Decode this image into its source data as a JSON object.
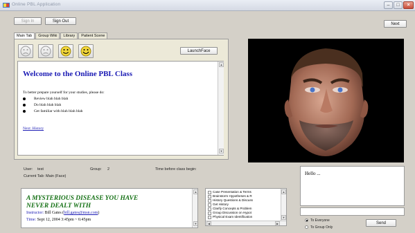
{
  "window": {
    "title": "Online PBL Application",
    "buttons": {
      "minimize": "–",
      "maximize": "□",
      "close": "×"
    }
  },
  "toolbar": {
    "sign_in": "Sign In",
    "sign_out": "Sign Out",
    "next": "Next"
  },
  "tabs": [
    {
      "label": "Main Tab",
      "active": true
    },
    {
      "label": "Group Wiki",
      "active": false
    },
    {
      "label": "Library",
      "active": false
    },
    {
      "label": "Patient Scene",
      "active": false
    }
  ],
  "face_icons": [
    "sad-face-icon",
    "sad-face-icon",
    "happy-face-icon",
    "happy-face-icon"
  ],
  "launch_face": "LaunchFace",
  "welcome": {
    "heading": "Welcome to the Online PBL Class",
    "intro": "To better prepare yourself for your studies, please do:",
    "items": [
      "Review blah blah blah",
      "Do blah blah blah",
      "Get familiar with blah blah blah"
    ],
    "next_link": "Next: History"
  },
  "status": {
    "user_label": "User:",
    "user_value": "test",
    "group_label": "Group:",
    "group_value": "2",
    "time_label": "Time before class begin:",
    "tab_label": "Current Tab:",
    "tab_value": "Main (Face)"
  },
  "announcement": {
    "title_line1": "A MYSTERIOUS DISEASE YOU HAVE",
    "title_line2": "NEVER DEALT WITH",
    "instructor_label": "Instructor:",
    "instructor_name": "Bill Gates",
    "instructor_email": "bill.gates@msn.com",
    "time_label": "Time:",
    "time_value": "Sept 12, 2004 3:45pm ~ 6:45pm"
  },
  "checklist": [
    "Case Presentation & Terms",
    "Brainstorm Hypotheses & R",
    "History Questions & Discuss",
    "Get History",
    "Clarify Concepts & Problem",
    "Group Discussion on Hypot",
    "Physical Exam Identification"
  ],
  "chat": {
    "message": "Hello ...",
    "send": "Send",
    "to_everyone": "To Everyone",
    "to_group": "To Group Only"
  },
  "colors": {
    "heading_blue": "#1a1ab4",
    "announce_green": "#147014",
    "face_yellow": "#f2d63a"
  }
}
